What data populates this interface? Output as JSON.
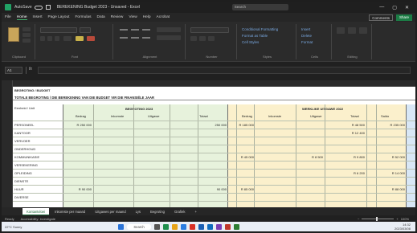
{
  "window": {
    "autosave": "AutoSave",
    "title": "BEREKENING Budget 2023 - Unsaved - Excel",
    "search": "Search",
    "controls": [
      "—",
      "▢",
      "✕"
    ]
  },
  "ribbon_tabs": [
    "File",
    "Home",
    "Insert",
    "Page Layout",
    "Formulas",
    "Data",
    "Review",
    "View",
    "Help",
    "Acrobat"
  ],
  "ribbon_tabs_active": "Home",
  "share": {
    "comments": "Comments",
    "share": "Share"
  },
  "ribbon": {
    "groups": [
      "Clipboard",
      "Font",
      "Alignment",
      "Number",
      "Styles",
      "Cells",
      "Editing"
    ],
    "styles": [
      "Conditional Formatting",
      "Format as Table",
      "Cell Styles"
    ],
    "cells": [
      "Insert",
      "Delete",
      "Format"
    ]
  },
  "formula_bar": {
    "name_box": "A1",
    "fx": "fx"
  },
  "sheet": {
    "header_text": "TOTALE BEGROTING / DIE BEREKENING VAN DIE BUDGET VIR DIE FINANSIËLE JAAR",
    "left_label_1": "BEGROTING / BUDGET",
    "left_label_2": "Eenheid / Unit",
    "green_title": "BEGROTING 2023",
    "yellow_title": "WERKLIKE UITGAWE 2022",
    "green_subheaders": [
      "Bedrag",
      "Inkomste",
      "Uitgawe",
      "Totaal"
    ],
    "yellow_subheaders": [
      "Bedrag",
      "Inkomste",
      "Uitgawe",
      "Totaal",
      "Saldo"
    ],
    "rows": [
      {
        "label": "PERSONEEL",
        "g1": "R 250 000",
        "g2": "",
        "g3": "",
        "y1": "250 000",
        "y2": "R 185 000",
        "y3": "",
        "y4": "R 48 500",
        "y5": "R 235 000"
      },
      {
        "label": "KANTOOR",
        "g1": "",
        "g2": "",
        "g3": "",
        "y1": "",
        "y2": "",
        "y3": "",
        "y4": "R 12 400",
        "y5": ""
      },
      {
        "label": "VERVOER",
        "g1": "",
        "g2": "",
        "g3": "",
        "y1": "",
        "y2": "",
        "y3": "",
        "y4": "",
        "y5": ""
      },
      {
        "label": "ONDERHOUD",
        "g1": "",
        "g2": "",
        "g3": "",
        "y1": "",
        "y2": "",
        "y3": "",
        "y4": "",
        "y5": ""
      },
      {
        "label": "KOMMUNIKASIE",
        "g1": "",
        "g2": "",
        "g3": "",
        "y1": "",
        "y2": "R 45 000",
        "y3": "R 8 500",
        "y4": "R 9 800",
        "y5": "R 52 000"
      },
      {
        "label": "VERSEKERING",
        "g1": "",
        "g2": "",
        "g3": "",
        "y1": "",
        "y2": "",
        "y3": "",
        "y4": "",
        "y5": ""
      },
      {
        "label": "OPLEIDING",
        "g1": "",
        "g2": "",
        "g3": "",
        "y1": "",
        "y2": "",
        "y3": "",
        "y4": "R 6 200",
        "y5": "R 14 000"
      },
      {
        "label": "DIENSTE",
        "g1": "",
        "g2": "",
        "g3": "",
        "y1": "",
        "y2": "",
        "y3": "",
        "y4": "",
        "y5": ""
      },
      {
        "label": "HUUR",
        "g1": "R 90 000",
        "g2": "",
        "g3": "",
        "y1": "90 000",
        "y2": "R 85 000",
        "y3": "",
        "y4": "",
        "y5": "R 88 000"
      },
      {
        "label": "DIVERSE",
        "g1": "",
        "g2": "",
        "g3": "",
        "y1": "",
        "y2": "",
        "y3": "",
        "y4": "",
        "y5": ""
      }
    ]
  },
  "sheet_tabs": [
    "Kontantvloei",
    "Inkomste per maand",
    "Uitgawes per maand",
    "Lys",
    "Begroting",
    "Grafiek"
  ],
  "sheet_tab_active": "Kontantvloei",
  "status": {
    "ready": "Ready",
    "accessibility": "Accessibility: Investigate",
    "zoom": "100%"
  },
  "taskbar": {
    "weather": "22°C Sunny",
    "search": "Search",
    "time": "14:32",
    "date": "2023/03/08"
  }
}
